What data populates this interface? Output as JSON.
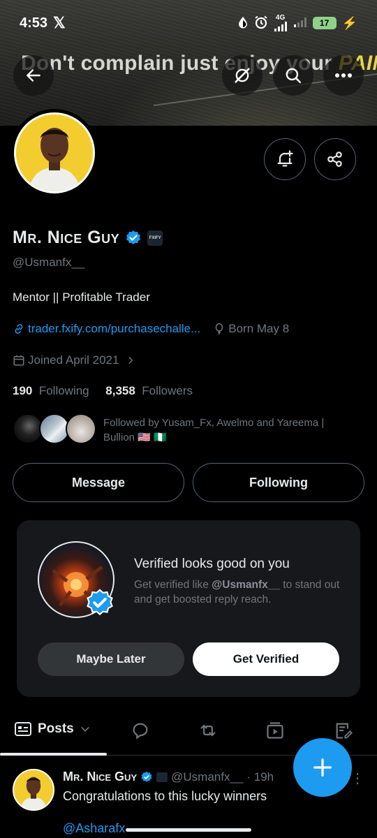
{
  "status_bar": {
    "time": "4:53",
    "network": "4G",
    "battery": "17"
  },
  "banner": {
    "text_main": "Don't complain just enjoy your ",
    "text_highlight": "PAIN."
  },
  "profile": {
    "display_name": "Mr. Nice Guy",
    "affiliate_badge": "FXIFY",
    "handle": "@Usmanfx__",
    "bio": "Mentor || Profitable Trader",
    "website": "trader.fxify.com/purchasechalle...",
    "born": "Born May 8",
    "joined": "Joined April 2021",
    "following_count": "190",
    "following_label": "Following",
    "followers_count": "8,358",
    "followers_label": "Followers",
    "followed_by": "Followed by Yusam_Fx, Awelmo and Yareema | Bullion 🇺🇸 🇳🇬"
  },
  "actions": {
    "message": "Message",
    "following": "Following"
  },
  "verified_card": {
    "title": "Verified looks good on you",
    "desc_prefix": "Get verified like ",
    "desc_handle": "@Usmanfx__",
    "desc_suffix": " to stand out and get boosted reply reach.",
    "maybe_later": "Maybe Later",
    "get_verified": "Get Verified"
  },
  "tabs": {
    "posts": "Posts"
  },
  "post": {
    "name": "Mr. Nice Guy",
    "handle": "@Usmanfx__",
    "time": "· 19h",
    "text": "Congratulations to this lucky winners",
    "mention": "@Asharafx"
  },
  "colors": {
    "accent": "#1d9bf0",
    "background": "#000000",
    "muted": "#71767b",
    "card": "#16181c"
  }
}
